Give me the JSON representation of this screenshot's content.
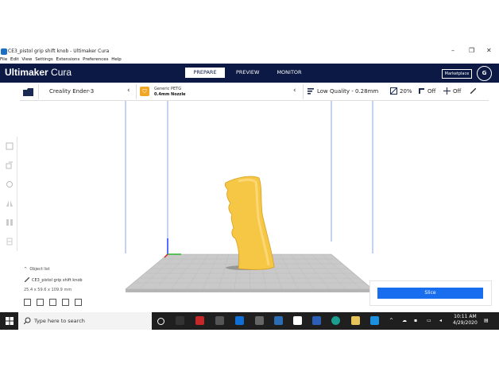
{
  "window": {
    "title": "CE3_pistol grip shift knob - Ultimaker Cura",
    "minimize": "–",
    "maximize": "❐",
    "close": "✕"
  },
  "menu": [
    "File",
    "Edit",
    "View",
    "Settings",
    "Extensions",
    "Preferences",
    "Help"
  ],
  "header": {
    "brand_bold": "Ultimaker",
    "brand_light": " Cura",
    "tabs": [
      {
        "label": "PREPARE",
        "active": true
      },
      {
        "label": "PREVIEW",
        "active": false
      },
      {
        "label": "MONITOR",
        "active": false
      }
    ],
    "marketplace": "Marketplace",
    "avatar": "G"
  },
  "toolbar": {
    "printer": "Creality Ender-3",
    "material_line1": "Generic PETG",
    "material_line2": "0.4mm Nozzle",
    "quality": "Low Quality - 0.28mm",
    "infill": "20%",
    "support": "Off",
    "adhesion": "Off"
  },
  "left_tools": [
    "move-tool-icon",
    "scale-tool-icon",
    "rotate-tool-icon",
    "mirror-tool-icon",
    "per-model-settings-icon",
    "support-blocker-icon"
  ],
  "object_panel": {
    "list_label": "Object list",
    "object_name": "CE3_pistol grip shift knob",
    "dimensions": "25.4 x 59.6 x 109.9 mm"
  },
  "slice": {
    "button_label": "Slice"
  },
  "taskbar": {
    "search_placeholder": "Type here to search",
    "time": "10:11 AM",
    "date": "4/29/2020"
  },
  "colors": {
    "header": "#0b1944",
    "accent": "#196ef0",
    "model": "#f7c948",
    "taskbar": "#1f1f1f"
  }
}
